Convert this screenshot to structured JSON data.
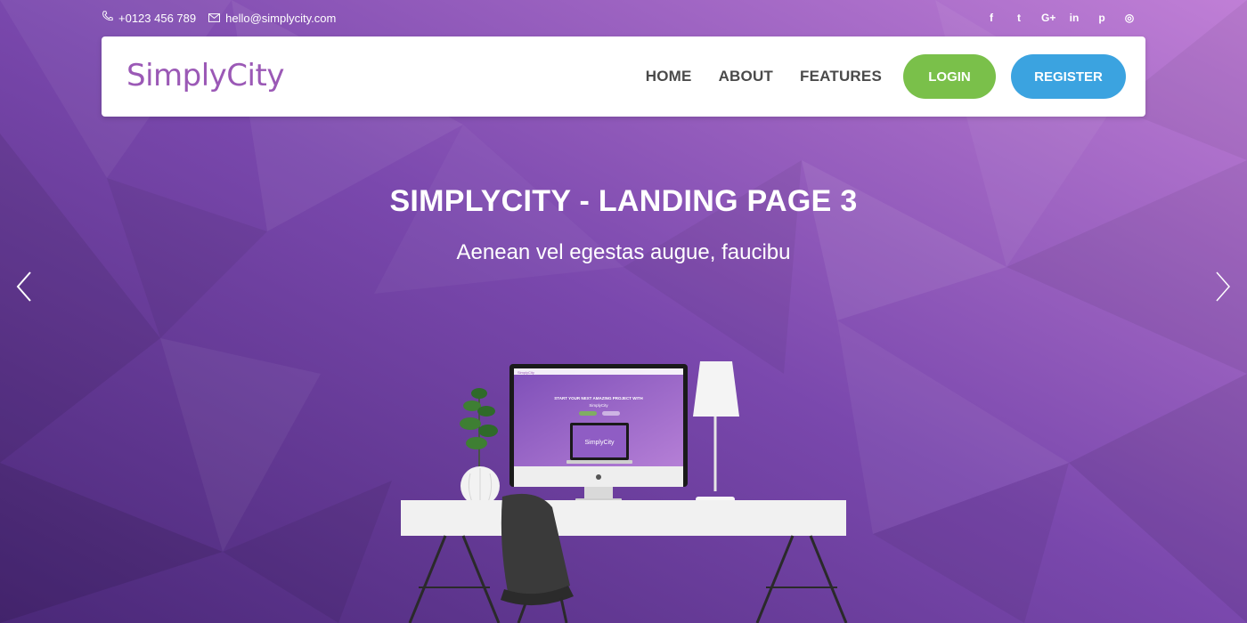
{
  "topbar": {
    "phone": "+0123 456 789",
    "email": "hello@simplycity.com",
    "social": [
      {
        "icon": "facebook-icon",
        "glyph": "f"
      },
      {
        "icon": "twitter-icon",
        "glyph": "t"
      },
      {
        "icon": "google-plus-icon",
        "glyph": "G+"
      },
      {
        "icon": "linkedin-icon",
        "glyph": "in"
      },
      {
        "icon": "pinterest-icon",
        "glyph": "p"
      },
      {
        "icon": "dribbble-icon",
        "glyph": "◎"
      }
    ]
  },
  "navbar": {
    "logo": "SimplyCity",
    "links": [
      "HOME",
      "ABOUT",
      "FEATURES"
    ],
    "login_label": "LOGIN",
    "register_label": "REGISTER"
  },
  "hero": {
    "title": "SIMPLYCITY - LANDING PAGE 3",
    "subtitle": "Aenean vel egestas augue, faucibu"
  },
  "mockup": {
    "monitor_heading": "START YOUR NEXT AMAZING PROJECT WITH",
    "monitor_subheading": "SimplyCity",
    "monitor_logo": "SimplyCity",
    "laptop_logo": "SimplyCity"
  },
  "colors": {
    "brand": "#9b59b6",
    "login": "#7ac04a",
    "register": "#3ba3e0",
    "background": "#6b3a9e"
  }
}
